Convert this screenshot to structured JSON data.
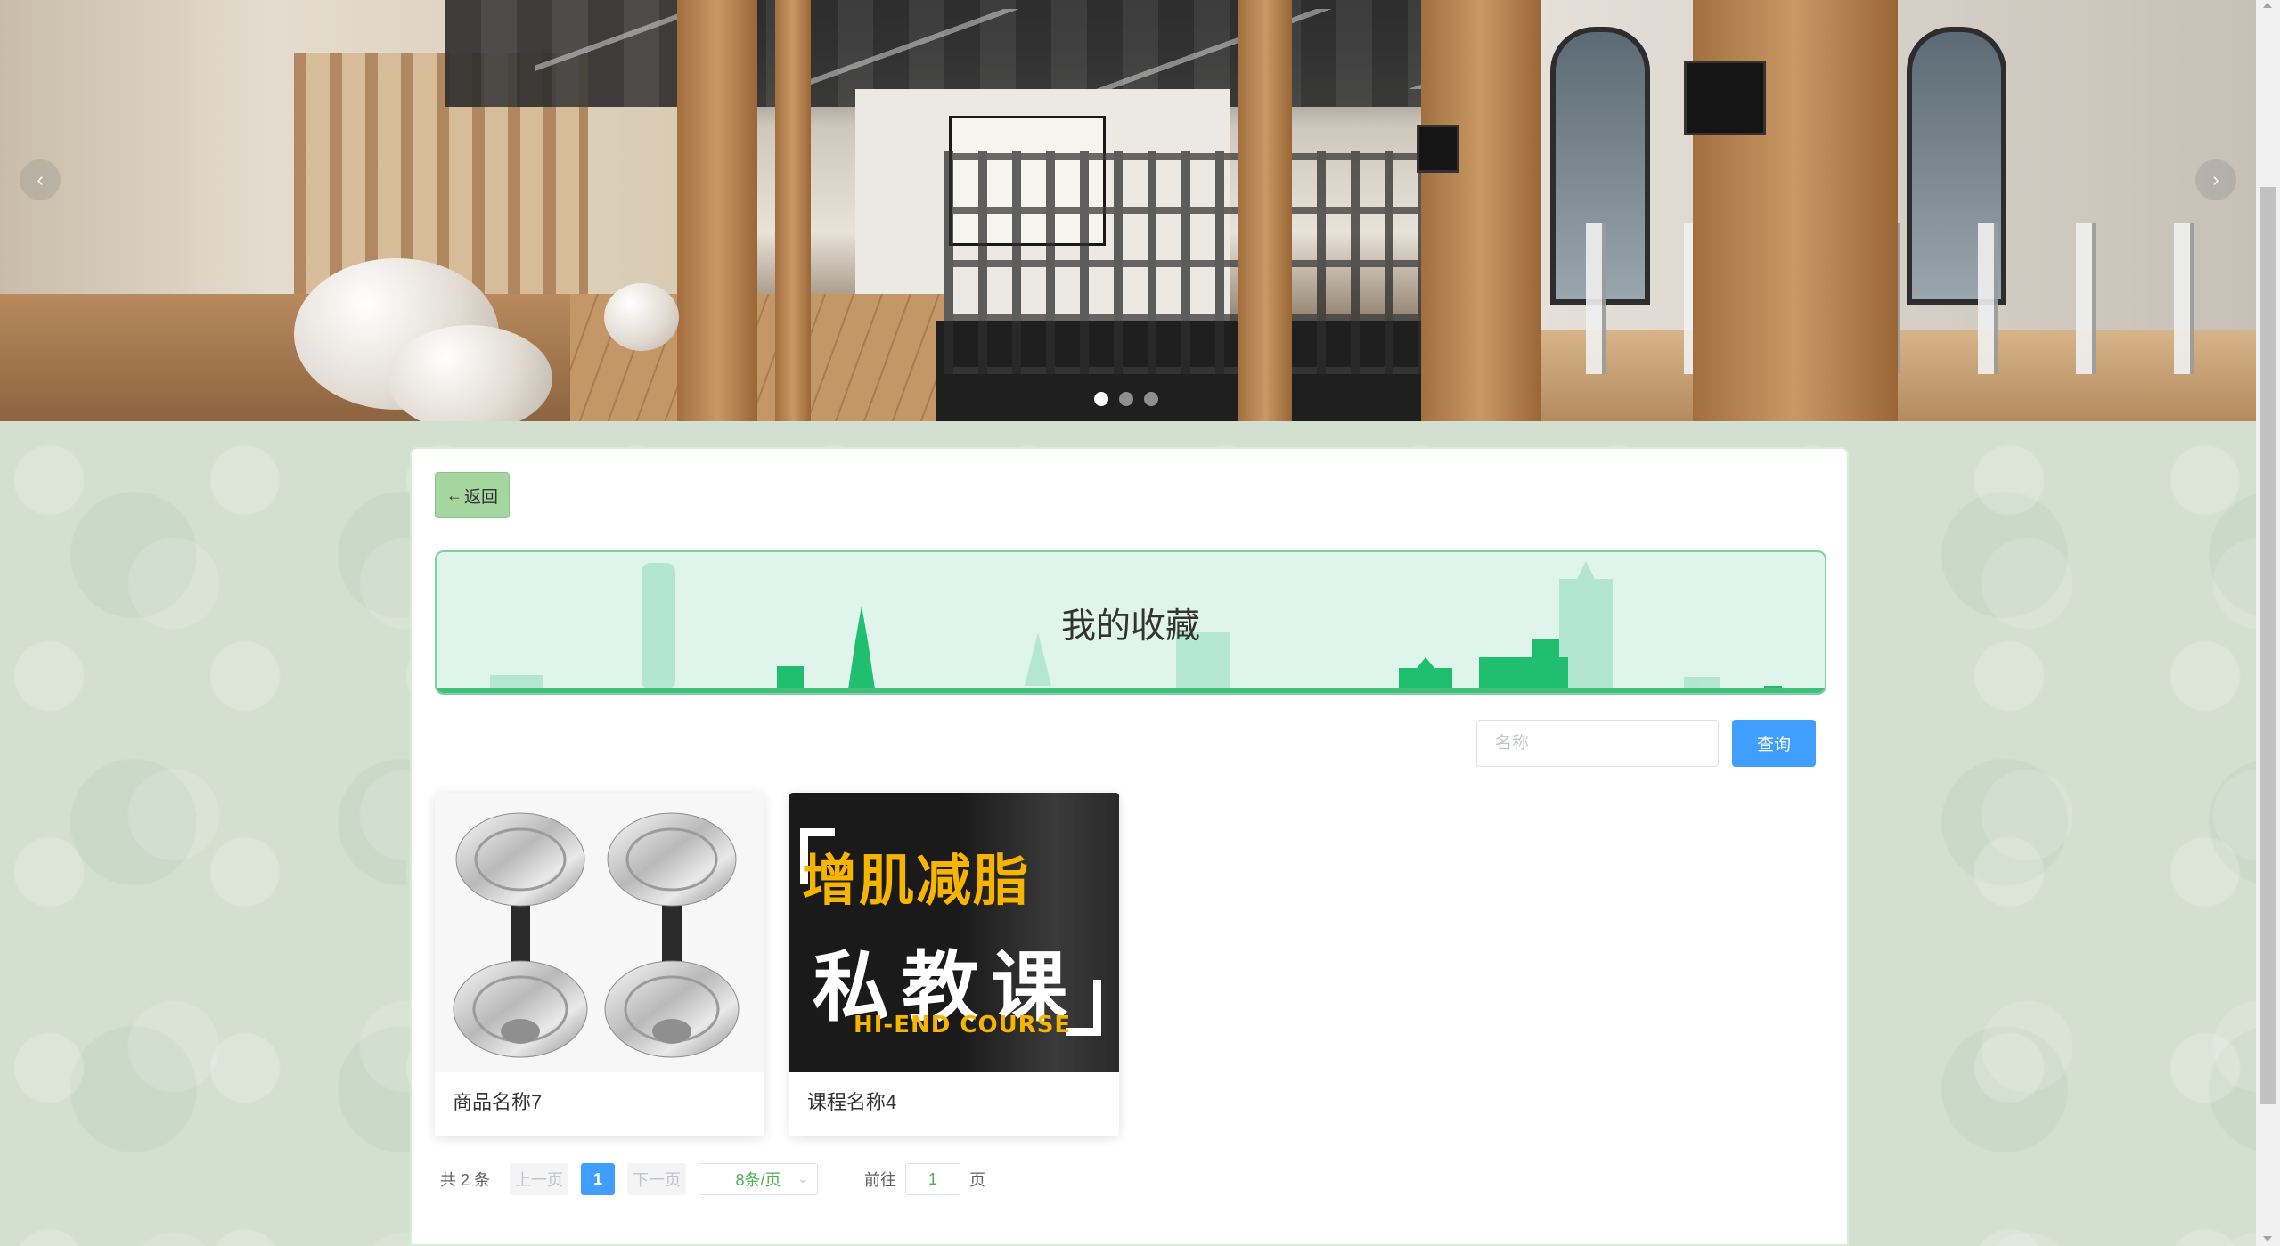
{
  "hero": {
    "prev_arrow": "‹",
    "next_arrow": "›",
    "slide_count": 3,
    "active_slide": 1
  },
  "back_button": {
    "icon": "arrow-left-icon",
    "arrow": "←",
    "label": "返回"
  },
  "banner": {
    "title": "我的收藏"
  },
  "search": {
    "placeholder": "名称",
    "value": "",
    "button_label": "查询"
  },
  "favorites": [
    {
      "name": "商品名称7",
      "image": "dumbbell-image"
    },
    {
      "name": "课程名称4",
      "image": "course-poster-image",
      "poster_line1": "增肌减脂",
      "poster_line2": "私教课",
      "poster_line3": "HI-END COURSE"
    }
  ],
  "pagination": {
    "total": "共 2 条",
    "prev": "上一页",
    "current_page": "1",
    "next": "下一页",
    "page_size": "8条/页",
    "goto_label": "前往",
    "goto_value": "1",
    "goto_suffix": "页"
  },
  "colors": {
    "primary": "#409eff",
    "back_button_bg": "#a5d6a0",
    "banner_bg": "#dff4ea",
    "banner_accent": "#3fbf7a",
    "poster_yellow": "#f7b500"
  }
}
